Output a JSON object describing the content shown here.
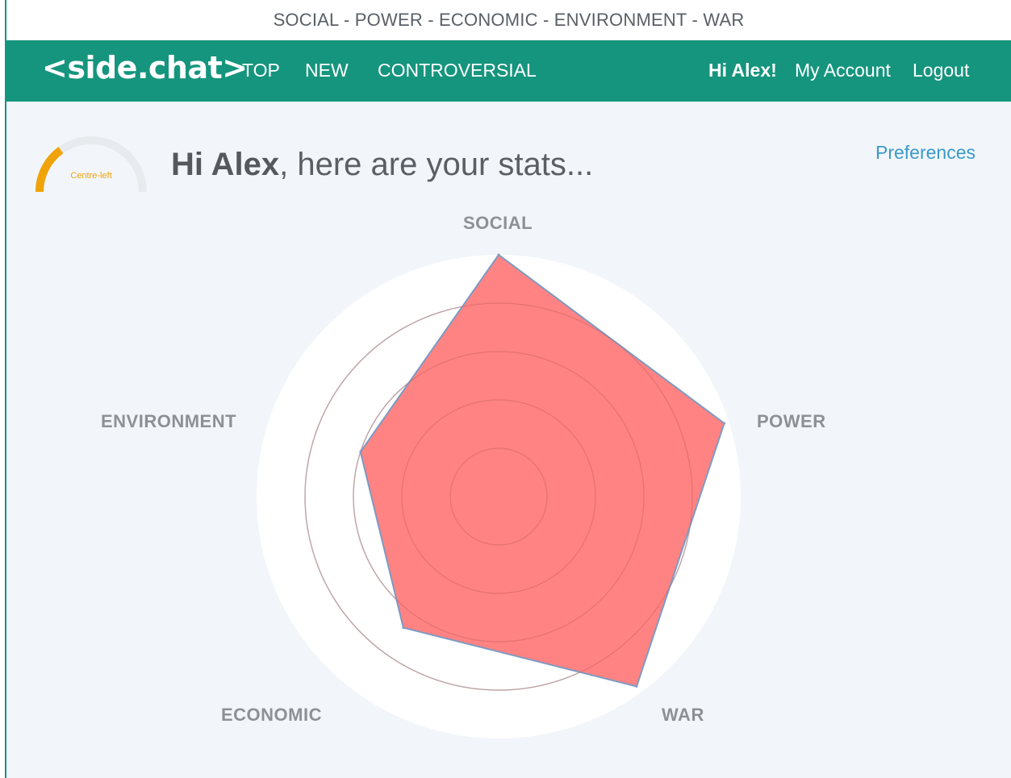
{
  "topbar": {
    "text": "SOCIAL - POWER - ECONOMIC - ENVIRONMENT - WAR"
  },
  "nav": {
    "logo": "<side.chat>",
    "links": [
      "TOP",
      "NEW",
      "CONTROVERSIAL"
    ],
    "greeting": "Hi Alex!",
    "account": "My Account",
    "logout": "Logout"
  },
  "stats": {
    "heading_name": "Hi Alex",
    "heading_rest": ", here are your stats...",
    "preferences": "Preferences",
    "gauge": {
      "label": "Centre-left",
      "value_fraction": 0.3,
      "color": "#f0a30a"
    }
  },
  "chart_data": {
    "type": "radar",
    "axes": [
      "SOCIAL",
      "POWER",
      "WAR",
      "ECONOMIC",
      "ENVIRONMENT"
    ],
    "values": [
      1.0,
      0.98,
      0.97,
      0.67,
      0.6
    ],
    "rings": [
      0.2,
      0.4,
      0.6,
      0.8
    ],
    "fill_color": "#ff7b7b",
    "stroke_color": "#7d9ac2"
  }
}
